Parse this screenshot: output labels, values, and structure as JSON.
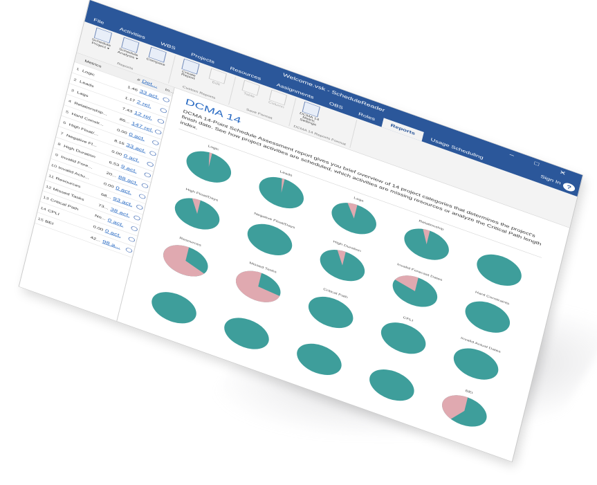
{
  "titlebar": {
    "app_title": "Welcome.vsk - ScheduleReader",
    "window_controls": "–  □  ✕"
  },
  "tabs": [
    "File",
    "Activities",
    "WBS",
    "Projects",
    "Resources",
    "Assignments",
    "OBS",
    "Roles",
    "Reports",
    "Usage Scheduling"
  ],
  "active_tab": "Reports",
  "signin": "Sign In",
  "help": "?",
  "ribbon": {
    "groups": [
      {
        "label": "Reports",
        "buttons": [
          {
            "label": "Schedule Project ▾",
            "dim": false
          },
          {
            "label": "Schedule Analysis ▾",
            "dim": false
          },
          {
            "label": "Compare",
            "dim": false
          }
        ]
      },
      {
        "label": "Custom Reports",
        "buttons": [
          {
            "label": "Create Report",
            "dim": false
          },
          {
            "label": "Edit",
            "dim": true
          }
        ]
      },
      {
        "label": "Save Format",
        "buttons": [
          {
            "label": "Table",
            "dim": true
          },
          {
            "label": "Column",
            "dim": true
          }
        ]
      },
      {
        "label": "DCMA 14 Reports Format",
        "buttons": [
          {
            "label": "DCMA 14 Metric Settings",
            "dim": false
          }
        ]
      }
    ]
  },
  "grid": {
    "headers": [
      "",
      "Metrics",
      "#",
      "Det...",
      "In..."
    ],
    "rows": [
      {
        "no": "1",
        "name": "Logic",
        "val": "1.46",
        "link": "33 act."
      },
      {
        "no": "2",
        "name": "Leads",
        "val": "1.17",
        "link": "2 rel."
      },
      {
        "no": "3",
        "name": "Lags",
        "val": "7.43",
        "link": "12 rel."
      },
      {
        "no": "4",
        "name": "Relationship...",
        "val": "86...",
        "link": "147 rel."
      },
      {
        "no": "5",
        "name": "Hard Constr...",
        "val": "0.00",
        "link": "0 act."
      },
      {
        "no": "6",
        "name": "High Float/...",
        "val": "8.16",
        "link": "33 act."
      },
      {
        "no": "7",
        "name": "Negative Fl...",
        "val": "0.00",
        "link": "0 act."
      },
      {
        "no": "8",
        "name": "High Duration",
        "val": "6.53",
        "link": "9 act."
      },
      {
        "no": "9",
        "name": "Invalid Fore...",
        "val": "20...",
        "link": "88 act."
      },
      {
        "no": "10",
        "name": "Invalid Actu...",
        "val": "0.00",
        "link": "0 act."
      },
      {
        "no": "11",
        "name": "Resources",
        "val": "68...",
        "link": "93 act."
      },
      {
        "no": "12",
        "name": "Missed Tasks",
        "val": "73...",
        "link": "38 act."
      },
      {
        "no": "13",
        "name": "Critical Path",
        "val": "No...",
        "link": "0 act."
      },
      {
        "no": "14",
        "name": "CPLI",
        "val": "0.00",
        "link": "0 act."
      },
      {
        "no": "15",
        "name": "BEI",
        "val": "42...",
        "link": "98 a..."
      }
    ]
  },
  "report": {
    "title": "DCMA 14",
    "description": "DCMA 14-Point Schedule Assessment report gives you brief overview of 14 project categories that determines the project's finish date. See how project activities are scheduled, which activities are missing resources or analyze the Critical Path length index."
  },
  "colors": {
    "teal": "#3e9e9b",
    "pink": "#e0a9b0",
    "blue": "#2b579a"
  },
  "pies": [
    {
      "label": "Logic",
      "fraction": 0.02
    },
    {
      "label": "Leads",
      "fraction": 0.02
    },
    {
      "label": "Lags",
      "fraction": 0.07
    },
    {
      "label": "Relationship",
      "fraction": 0.05
    },
    {
      "label": "",
      "fraction": 0
    },
    {
      "label": "High Float/Days",
      "fraction": 0.06
    },
    {
      "label": "Negative Float/Days",
      "fraction": 0
    },
    {
      "label": "High Duration",
      "fraction": 0.06
    },
    {
      "label": "Invalid Forecast Dates",
      "fraction": 0.2
    },
    {
      "label": "Hard Constraints",
      "fraction": 0
    },
    {
      "label": "Resources",
      "fraction": 0.68
    },
    {
      "label": "Missed Tasks",
      "fraction": 0.73
    },
    {
      "label": "Critical Path",
      "fraction": 0
    },
    {
      "label": "CPLI",
      "fraction": 0
    },
    {
      "label": "Invalid Actual Dates",
      "fraction": 0
    },
    {
      "label": "",
      "fraction": 0
    },
    {
      "label": "",
      "fraction": 0
    },
    {
      "label": "",
      "fraction": 0
    },
    {
      "label": "",
      "fraction": 0
    },
    {
      "label": "BEI",
      "fraction": 0.42
    }
  ]
}
